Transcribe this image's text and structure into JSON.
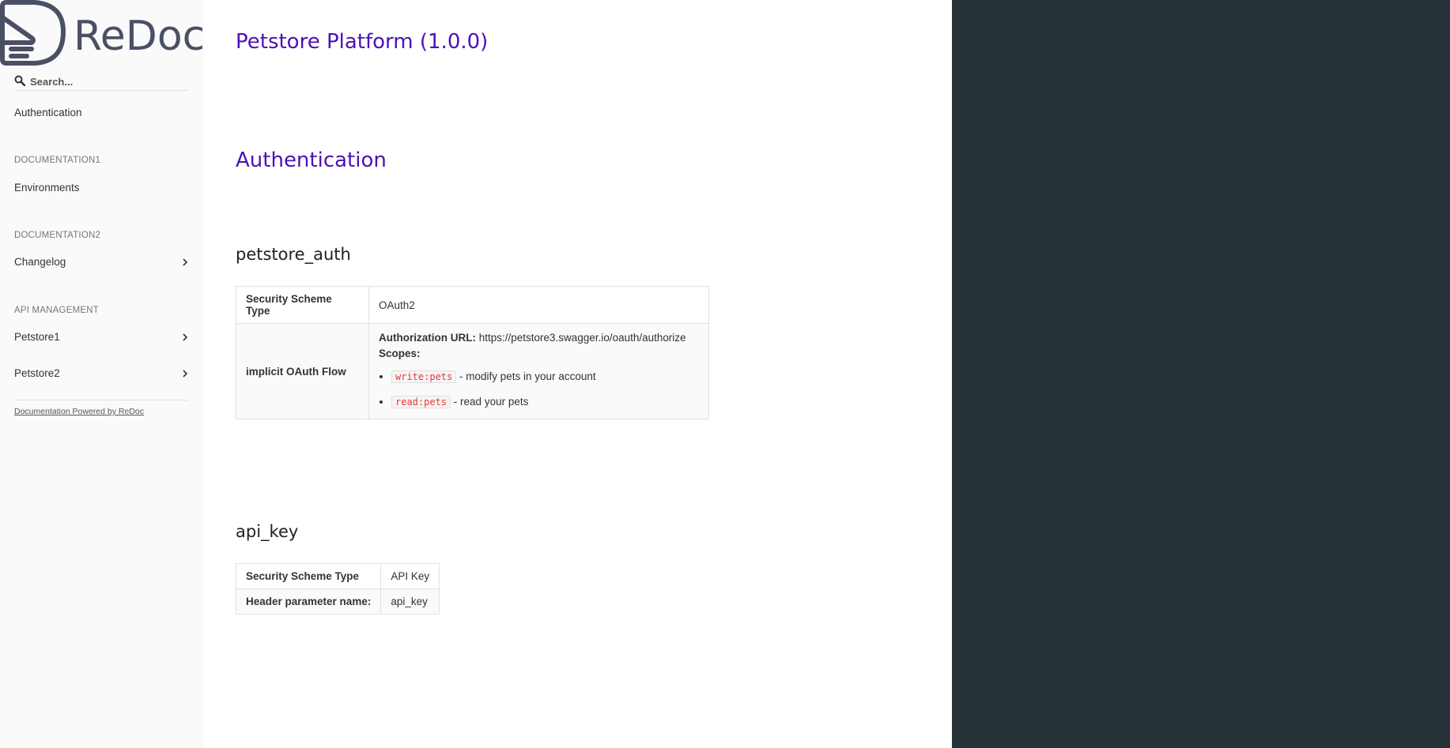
{
  "sidebar": {
    "logo_text": "ReDoc",
    "search": {
      "placeholder": "Search..."
    },
    "items": [
      {
        "label": "Authentication"
      }
    ],
    "sections": [
      {
        "title": "DOCUMENTATION1",
        "items": [
          {
            "label": "Environments"
          }
        ]
      },
      {
        "title": "DOCUMENTATION2",
        "items": [
          {
            "label": "Changelog"
          }
        ]
      },
      {
        "title": "API MANAGEMENT",
        "items": [
          {
            "label": "Petstore1"
          },
          {
            "label": "Petstore2"
          }
        ]
      }
    ],
    "powered_by": "Documentation Powered by ReDoc"
  },
  "main": {
    "api_title": "Petstore Platform (1.0.0)",
    "auth_heading": "Authentication",
    "schemes": [
      {
        "name": "petstore_auth",
        "type_label": "Security Scheme Type",
        "type_value": "OAuth2",
        "flow_label": "implicit OAuth Flow",
        "auth_url_label": "Authorization URL:",
        "auth_url": "https://petstore3.swagger.io/oauth/authorize",
        "scopes_label": "Scopes:",
        "scopes": [
          {
            "name": "write:pets",
            "desc": "- modify pets in your account"
          },
          {
            "name": "read:pets",
            "desc": "- read your pets"
          }
        ]
      },
      {
        "name": "api_key",
        "type_label": "Security Scheme Type",
        "type_value": "API Key",
        "header_label": "Header parameter name:",
        "header_value": "api_key"
      }
    ]
  },
  "colors": {
    "sidebar_bg": "#fafafa",
    "heading_purple": "#4b12b6",
    "right_panel_bg": "#263238",
    "scope_code_red": "#e53935"
  }
}
